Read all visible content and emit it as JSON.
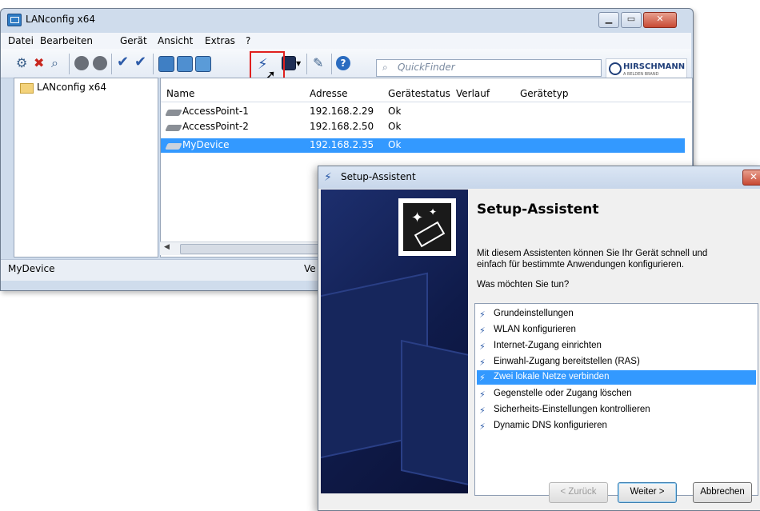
{
  "main_window": {
    "title": "LANconfig x64",
    "menu": [
      "Datei",
      "Bearbeiten",
      "Gerät",
      "Ansicht",
      "Extras",
      "?"
    ],
    "quickfinder_placeholder": "QuickFinder",
    "brand": "HIRSCHMANN",
    "brand_sub": "A BELDEN BRAND",
    "tree": {
      "root_label": "LANconfig x64"
    },
    "columns": [
      "Name",
      "Adresse",
      "Gerätestatus",
      "Verlauf",
      "Gerätetyp"
    ],
    "devices": [
      {
        "name": "AccessPoint-1",
        "address": "192.168.2.29",
        "status": "Ok"
      },
      {
        "name": "AccessPoint-2",
        "address": "192.168.2.50",
        "status": "Ok"
      },
      {
        "name": "MyDevice",
        "address": "192.168.2.35",
        "status": "Ok"
      }
    ],
    "status_left": "MyDevice",
    "status_right_partial": "Ve"
  },
  "setup_dialog": {
    "title": "Setup-Assistent",
    "heading": "Setup-Assistent",
    "intro_line1": "Mit diesem Assistenten können Sie Ihr Gerät schnell und",
    "intro_line2": "einfach für bestimmte Anwendungen konfigurieren.",
    "question": "Was möchten Sie tun?",
    "options": [
      "Grundeinstellungen",
      "WLAN konfigurieren",
      "Internet-Zugang einrichten",
      "Einwahl-Zugang bereitstellen (RAS)",
      "Zwei lokale Netze verbinden",
      "Gegenstelle oder Zugang löschen",
      "Sicherheits-Einstellungen kontrollieren",
      "Dynamic DNS konfigurieren"
    ],
    "selected_option": "Zwei lokale Netze verbinden",
    "buttons": {
      "back": "< Zurück",
      "next": "Weiter >",
      "cancel": "Abbrechen"
    }
  },
  "colors": {
    "selection": "#3399ff",
    "highlight_box": "#e0201e",
    "wizard_panel": "#0f1b4a"
  }
}
